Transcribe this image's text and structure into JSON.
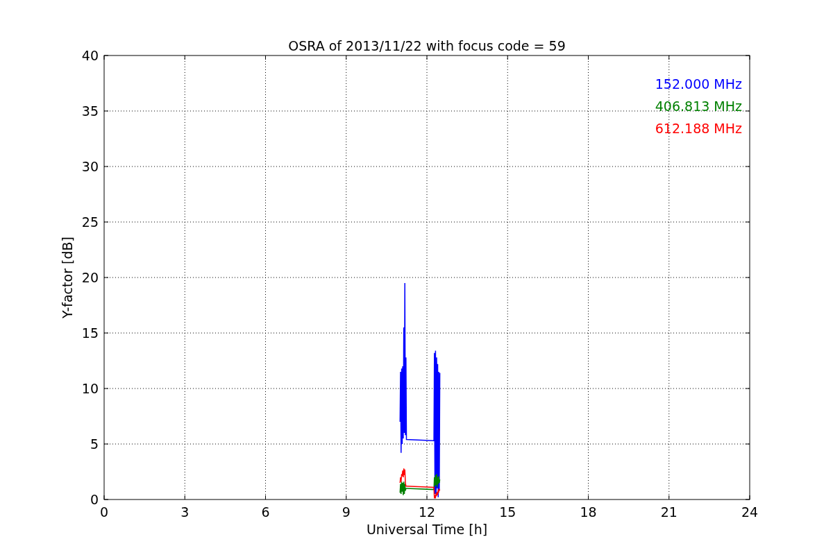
{
  "chart_data": {
    "type": "line",
    "title": "OSRA of 2013/11/22 with focus code = 59",
    "xlabel": "Universal Time [h]",
    "ylabel": "Y-factor [dB]",
    "x": [
      11.0,
      11.02,
      11.04,
      11.06,
      11.08,
      11.1,
      11.12,
      11.14,
      11.16,
      11.18,
      11.2,
      11.22,
      11.24,
      12.26,
      12.28,
      12.3,
      12.32,
      12.34,
      12.36,
      12.38,
      12.4,
      12.42,
      12.44,
      12.46,
      12.48
    ],
    "series": [
      {
        "name": "152.000 MHz",
        "color": "#0000ff",
        "values": [
          7,
          11.5,
          4.2,
          11.8,
          5,
          12,
          5.5,
          15.5,
          6,
          19.5,
          5.8,
          12.8,
          5.4,
          5.3,
          13.2,
          0.5,
          13.4,
          0.3,
          12.8,
          1,
          12.2,
          0.2,
          11.5,
          0.8,
          11.4
        ]
      },
      {
        "name": "406.813 MHz",
        "color": "#008000",
        "values": [
          0.6,
          1.4,
          0.5,
          1.6,
          0.7,
          1.5,
          0.4,
          1.6,
          0.5,
          1.4,
          0.8,
          1.0,
          1.0,
          0.9,
          2.0,
          1.2,
          2.2,
          1.3,
          2.3,
          1.1,
          2.0,
          1.4,
          2.1,
          1.5,
          1.8
        ]
      },
      {
        "name": "612.188 MHz",
        "color": "#ff0000",
        "values": [
          1.5,
          2.0,
          1.6,
          2.3,
          2.1,
          2.6,
          2.0,
          2.8,
          2.2,
          2.7,
          1.5,
          1.2,
          1.2,
          1.1,
          0.1,
          0.3,
          0.2,
          0.5,
          0.4,
          0.6,
          0.5,
          0.8,
          0.7,
          0.9,
          0.8
        ]
      }
    ],
    "grid": true,
    "xlim": [
      0,
      24
    ],
    "ylim": [
      0,
      40
    ],
    "xticks": [
      0,
      3,
      6,
      9,
      12,
      15,
      18,
      21,
      24
    ],
    "yticks": [
      0,
      5,
      10,
      15,
      20,
      25,
      30,
      35,
      40
    ]
  }
}
